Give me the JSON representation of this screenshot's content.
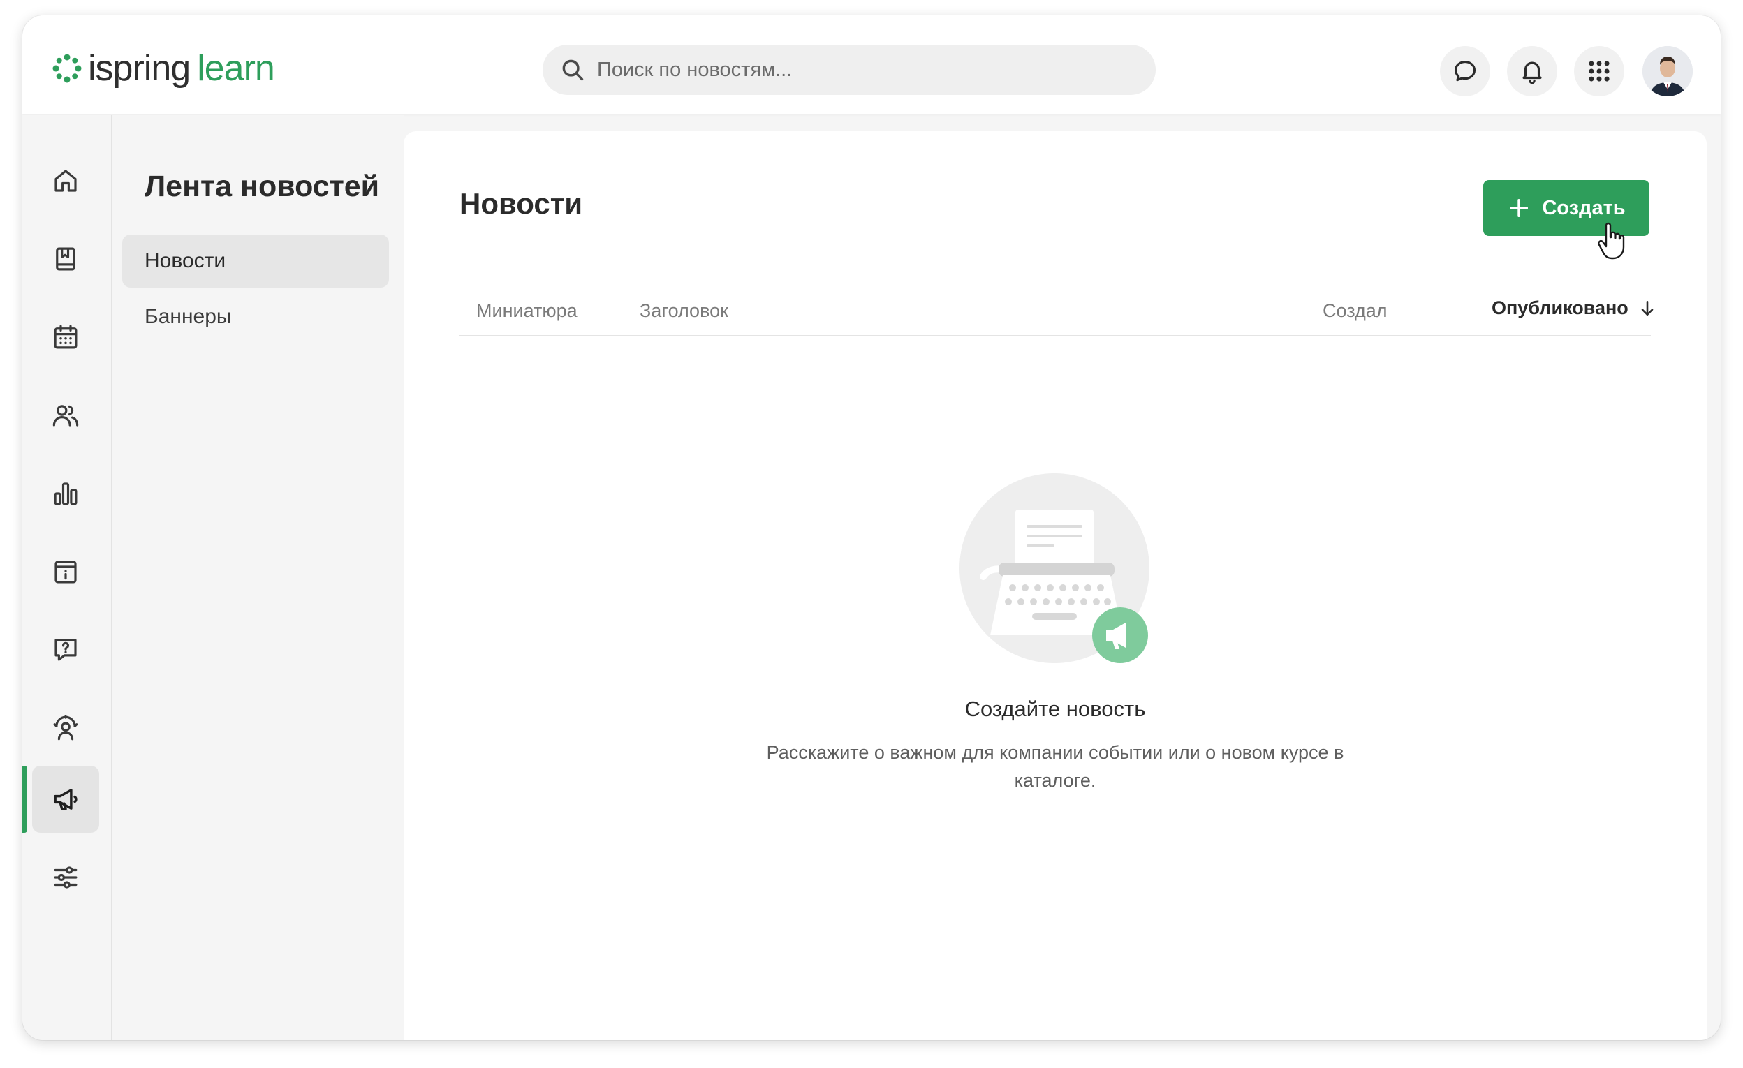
{
  "brand": {
    "name_part1": "ispring",
    "name_part2": "learn",
    "accent_color": "#2e9e5b"
  },
  "search": {
    "placeholder": "Поиск по новостям..."
  },
  "header_actions": [
    {
      "icon": "chat-bubble-icon"
    },
    {
      "icon": "bell-icon"
    },
    {
      "icon": "apps-grid-icon"
    },
    {
      "icon": "user-avatar"
    }
  ],
  "rail": {
    "items": [
      {
        "icon": "home-icon",
        "active": false
      },
      {
        "icon": "book-icon",
        "active": false
      },
      {
        "icon": "calendar-icon",
        "active": false
      },
      {
        "icon": "users-icon",
        "active": false
      },
      {
        "icon": "bar-chart-icon",
        "active": false
      },
      {
        "icon": "info-board-icon",
        "active": false
      },
      {
        "icon": "question-chat-icon",
        "active": false
      },
      {
        "icon": "person-rating-icon",
        "active": false
      },
      {
        "icon": "megaphone-icon",
        "active": true
      },
      {
        "icon": "sliders-icon",
        "active": false
      }
    ]
  },
  "subnav": {
    "title": "Лента новостей",
    "items": [
      {
        "label": "Новости",
        "active": true
      },
      {
        "label": "Баннеры",
        "active": false
      }
    ]
  },
  "main": {
    "title": "Новости",
    "create_label": "Создать",
    "columns": [
      {
        "label": "Миниатюра"
      },
      {
        "label": "Заголовок"
      },
      {
        "label": "Создал"
      },
      {
        "label": "Опубликовано",
        "sorted": "desc"
      }
    ],
    "empty": {
      "title": "Создайте новость",
      "description": "Расскажите о важном для компании событии или о новом курсе в каталоге."
    }
  }
}
